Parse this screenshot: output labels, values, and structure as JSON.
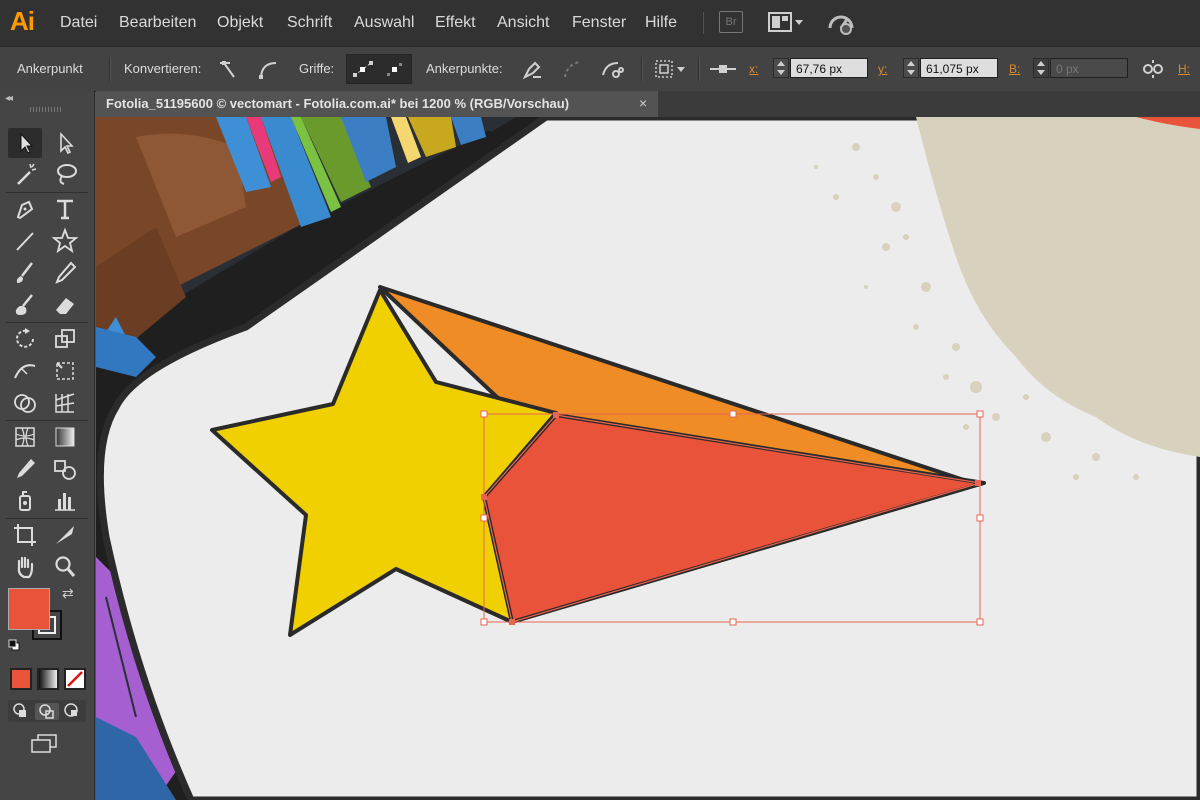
{
  "app": {
    "logo": "Ai"
  },
  "menu": [
    "Datei",
    "Bearbeiten",
    "Objekt",
    "Schrift",
    "Auswahl",
    "Effekt",
    "Ansicht",
    "Fenster",
    "Hilfe"
  ],
  "menubar_icons": [
    "bridge-icon",
    "arrange-documents-icon",
    "gpu-performance-icon"
  ],
  "bridge_label": "Br",
  "control": {
    "mode_label": "Ankerpunkt",
    "convert_label": "Konvertieren:",
    "handles_label": "Griffe:",
    "anchors_label": "Ankerpunkte:",
    "x_label": "x:",
    "x_value": "67,76 px",
    "y_label": "y:",
    "y_value": "61,075 px",
    "w_label": "B:",
    "w_value": "0 px",
    "h_label": "H:"
  },
  "document": {
    "tab_title": "Fotolia_51195600 © vectomart - Fotolia.com.ai* bei 1200 % (RGB/Vorschau)",
    "close": "×"
  },
  "colors": {
    "fill": "#e9533a",
    "star": "#f0d000",
    "tail_orange": "#f08c25",
    "tail_red": "#e9533a",
    "selection": "#e86552",
    "paper": "#ececec",
    "beige": "#d7d1be",
    "accent": "#ff9a00"
  },
  "tools": [
    "selection-tool-icon",
    "direct-selection-tool-icon",
    "magic-wand-tool-icon",
    "lasso-tool-icon",
    "pen-tool-icon",
    "type-tool-icon",
    "line-tool-icon",
    "star-tool-icon",
    "paintbrush-tool-icon",
    "pencil-tool-icon",
    "blob-brush-tool-icon",
    "eraser-tool-icon",
    "rotate-tool-icon",
    "scale-tool-icon",
    "width-tool-icon",
    "free-transform-tool-icon",
    "shape-builder-tool-icon",
    "perspective-grid-tool-icon",
    "mesh-tool-icon",
    "gradient-tool-icon",
    "eyedropper-tool-icon",
    "blend-tool-icon",
    "symbol-sprayer-tool-icon",
    "column-graph-tool-icon",
    "artboard-tool-icon",
    "slice-tool-icon",
    "hand-tool-icon",
    "zoom-tool-icon"
  ]
}
